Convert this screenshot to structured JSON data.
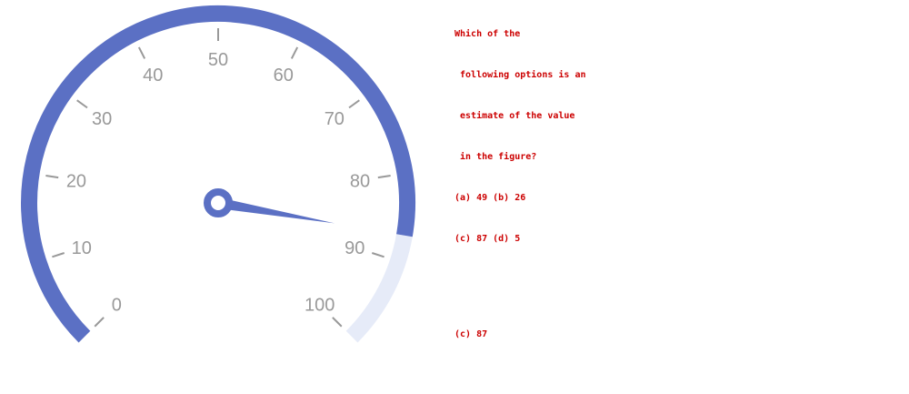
{
  "question": {
    "line1": "Which of the",
    "line2": " following options is an",
    "line3": " estimate of the value",
    "line4": " in the figure?",
    "line5": "(a) 49 (b) 26",
    "line6": "(c) 87 (d) 5",
    "answer": "(c) 87"
  },
  "chart_data": {
    "type": "gauge",
    "min": 0,
    "max": 100,
    "value": 87,
    "tick_labels": [
      "0",
      "10",
      "20",
      "30",
      "40",
      "50",
      "60",
      "70",
      "80",
      "90",
      "100"
    ],
    "start_angle_deg": 225,
    "end_angle_deg": -45,
    "colors": {
      "progress": "#5b70c4",
      "track": "#e6ebf8",
      "tick": "#999999",
      "label": "#999999",
      "pointer": "#5b70c4"
    }
  }
}
